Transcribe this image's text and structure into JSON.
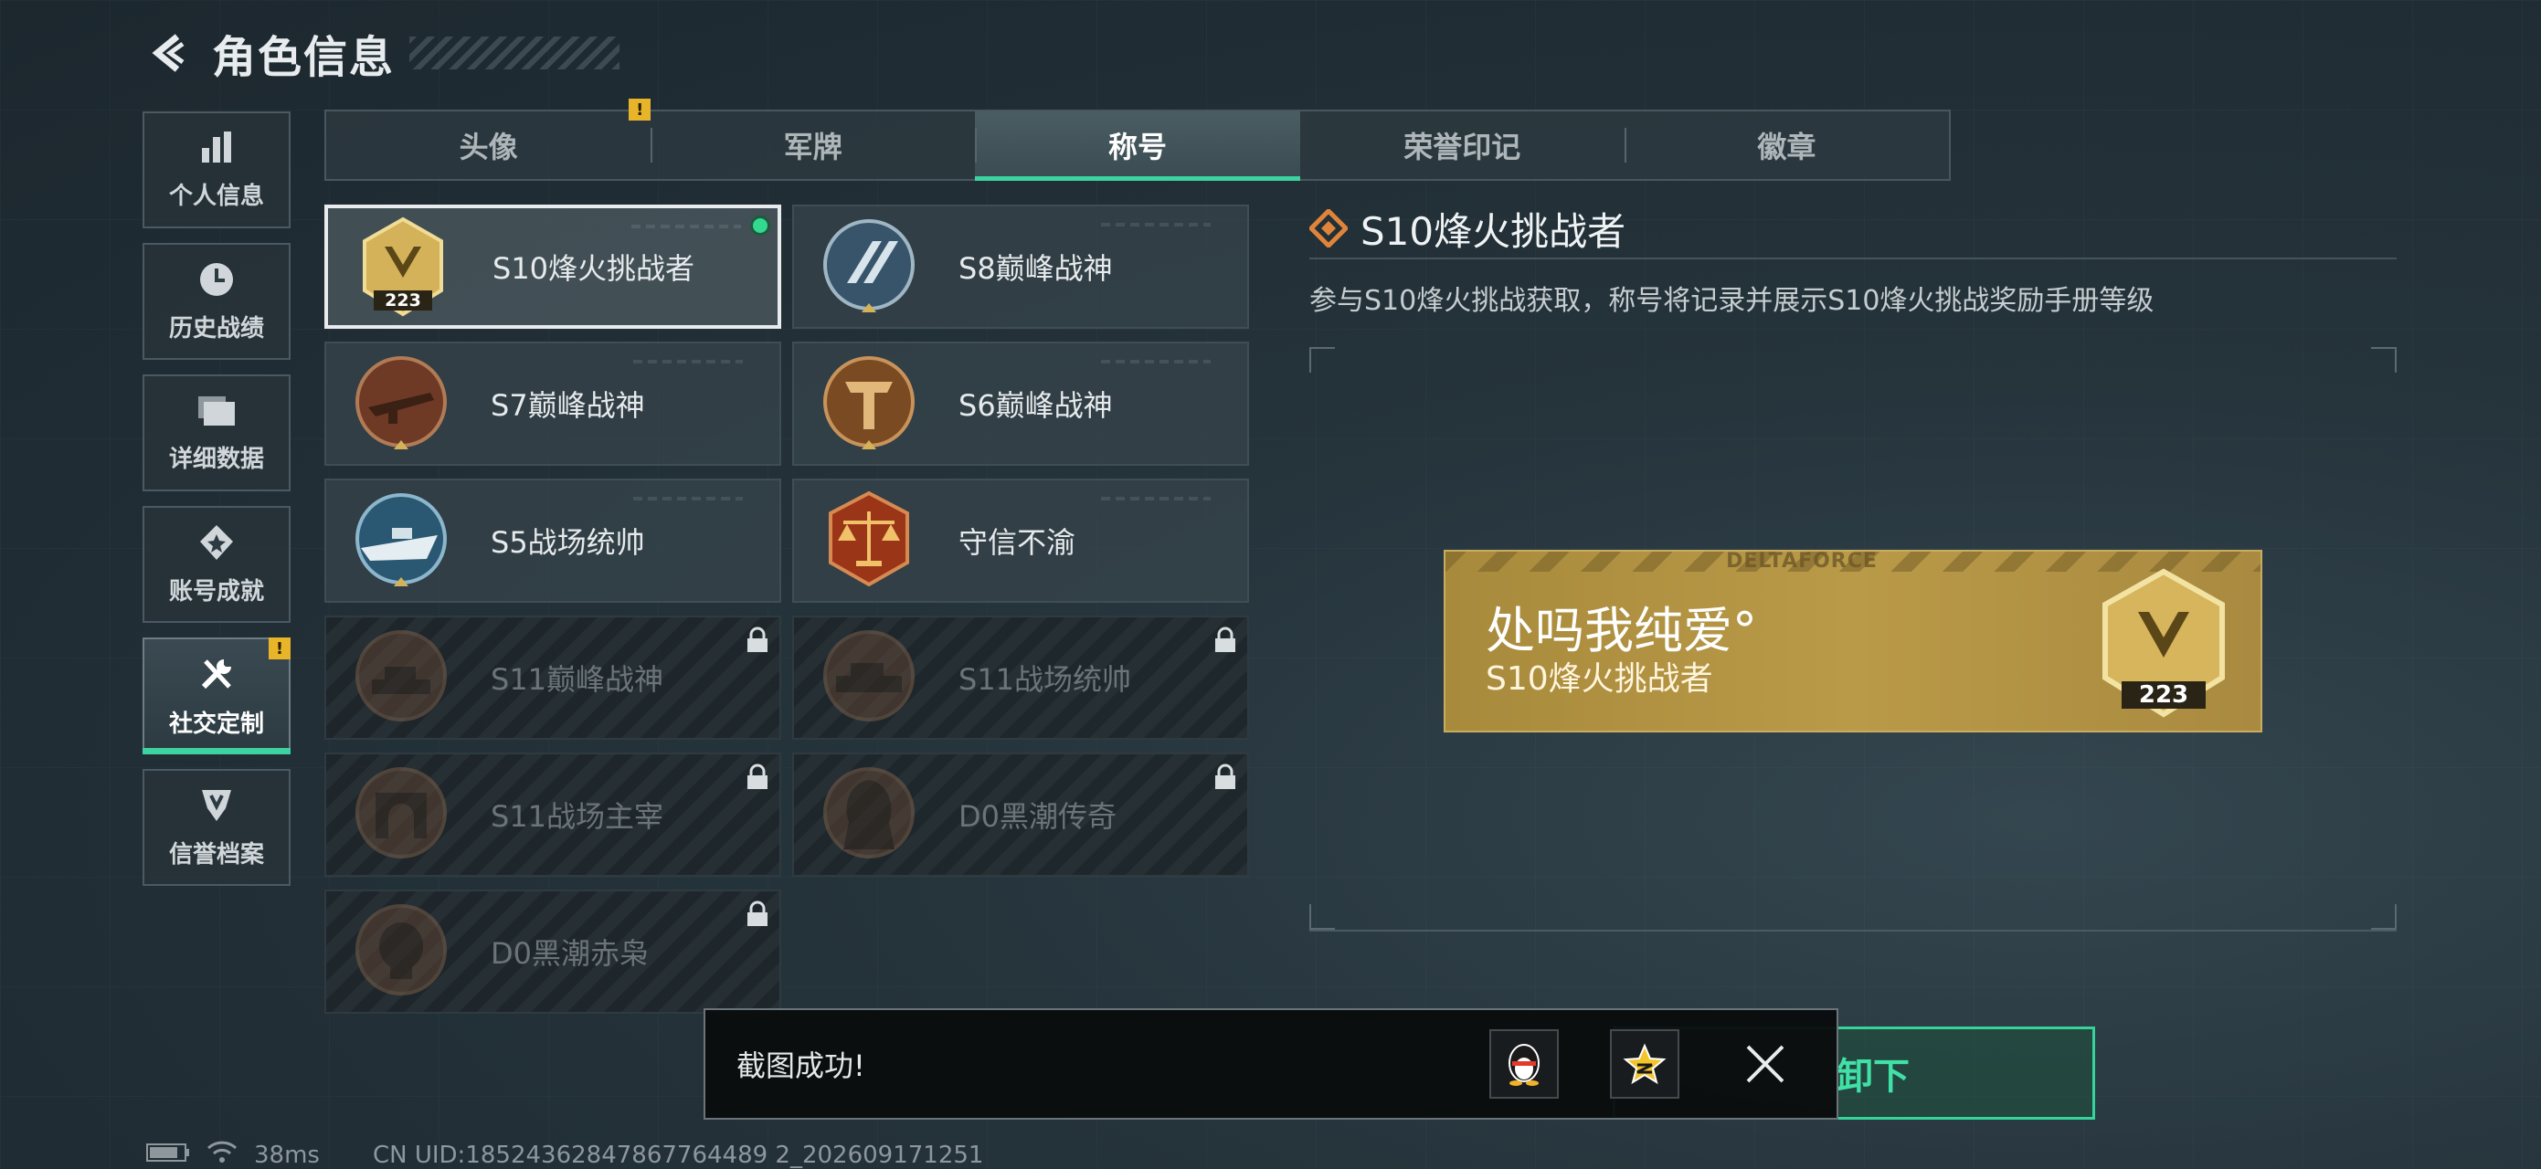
{
  "header": {
    "title": "角色信息"
  },
  "sidebar": {
    "items": [
      {
        "label": "个人信息",
        "icon": "bar-chart-icon"
      },
      {
        "label": "历史战绩",
        "icon": "clock-icon"
      },
      {
        "label": "详细数据",
        "icon": "folder-icon"
      },
      {
        "label": "账号成就",
        "icon": "medal-icon"
      },
      {
        "label": "社交定制",
        "icon": "tools-icon",
        "active": true,
        "badge": "!"
      },
      {
        "label": "信誉档案",
        "icon": "shield-icon"
      }
    ]
  },
  "tabs": [
    {
      "label": "头像",
      "badge": "!"
    },
    {
      "label": "军牌"
    },
    {
      "label": "称号",
      "active": true
    },
    {
      "label": "荣誉印记"
    },
    {
      "label": "徽章"
    }
  ],
  "titles": [
    {
      "name": "S10烽火挑战者",
      "selected": true,
      "equipped": true,
      "level": "223"
    },
    {
      "name": "S8巅峰战神"
    },
    {
      "name": "S7巅峰战神"
    },
    {
      "name": "S6巅峰战神"
    },
    {
      "name": "S5战场统帅"
    },
    {
      "name": "守信不渝"
    },
    {
      "name": "S11巅峰战神",
      "locked": true
    },
    {
      "name": "S11战场统帅",
      "locked": true
    },
    {
      "name": "S11战场主宰",
      "locked": true
    },
    {
      "name": "D0黑潮传奇",
      "locked": true
    },
    {
      "name": "D0黑潮赤枭",
      "locked": true
    }
  ],
  "detail": {
    "title": "S10烽火挑战者",
    "description": "参与S10烽火挑战获取，称号将记录并展示S10烽火挑战奖励手册等级"
  },
  "nameplate": {
    "brand": "DELTAFORCE",
    "player_name": "处吗我纯爱°",
    "title": "S10烽火挑战者",
    "level": "223"
  },
  "unequip_button": {
    "label": "卸下"
  },
  "toast": {
    "message": "截图成功!"
  },
  "status": {
    "ping": "38ms",
    "uid": "CN UID:18524362847867764489 2_202609171251"
  },
  "colors": {
    "accent": "#3cd3a0",
    "gold": "#b99a48",
    "warning": "#e8b52a"
  }
}
